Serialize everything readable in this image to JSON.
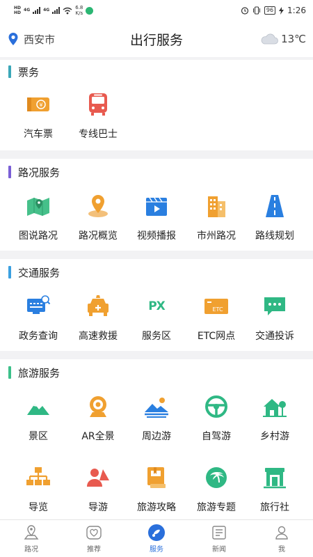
{
  "status_bar": {
    "net_top": "HD",
    "net_bottom": "HD",
    "signal_1": "4G",
    "signal_2": "4G",
    "speed_value": "6.8",
    "speed_unit": "K/s",
    "battery": "96",
    "time": "1:26"
  },
  "header": {
    "location": "西安市",
    "title": "出行服务",
    "temperature": "13℃"
  },
  "sections": [
    {
      "title": "票务",
      "accent": "#3ba7b8",
      "items": [
        {
          "label": "汽车票",
          "icon": "ticket-icon"
        },
        {
          "label": "专线巴士",
          "icon": "bus-icon"
        }
      ]
    },
    {
      "title": "路况服务",
      "accent": "#7a5fd6",
      "items": [
        {
          "label": "图说路况",
          "icon": "map-icon"
        },
        {
          "label": "路况概览",
          "icon": "location-pin-icon"
        },
        {
          "label": "视频播报",
          "icon": "video-icon"
        },
        {
          "label": "市州路况",
          "icon": "city-buildings-icon"
        },
        {
          "label": "路线规划",
          "icon": "highway-icon"
        }
      ]
    },
    {
      "title": "交通服务",
      "accent": "#3ba0e0",
      "items": [
        {
          "label": "政务查询",
          "icon": "government-query-icon"
        },
        {
          "label": "高速救援",
          "icon": "rescue-car-icon"
        },
        {
          "label": "服务区",
          "icon": "service-area-icon",
          "icon_text": "PX"
        },
        {
          "label": "ETC网点",
          "icon": "etc-card-icon",
          "icon_text": "ETC"
        },
        {
          "label": "交通投诉",
          "icon": "complaint-chat-icon"
        }
      ]
    },
    {
      "title": "旅游服务",
      "accent": "#3cc08a",
      "items": [
        {
          "label": "景区",
          "icon": "scenic-mountain-icon"
        },
        {
          "label": "AR全景",
          "icon": "ar-panorama-icon"
        },
        {
          "label": "周边游",
          "icon": "landscape-icon"
        },
        {
          "label": "自驾游",
          "icon": "steering-wheel-icon"
        },
        {
          "label": "乡村游",
          "icon": "village-house-icon"
        },
        {
          "label": "导览",
          "icon": "org-chart-icon"
        },
        {
          "label": "导游",
          "icon": "tour-guide-icon"
        },
        {
          "label": "旅游攻略",
          "icon": "guide-book-icon"
        },
        {
          "label": "旅游专题",
          "icon": "island-icon"
        },
        {
          "label": "旅行社",
          "icon": "travel-agency-icon"
        }
      ]
    }
  ],
  "tabbar": {
    "tabs": [
      {
        "label": "路况",
        "icon": "road-tab-icon"
      },
      {
        "label": "推荐",
        "icon": "heart-tab-icon"
      },
      {
        "label": "服务",
        "icon": "service-tab-icon",
        "active": true
      },
      {
        "label": "新闻",
        "icon": "news-tab-icon"
      },
      {
        "label": "我",
        "icon": "profile-tab-icon"
      }
    ]
  },
  "colors": {
    "blue": "#2a6fdb",
    "orange": "#f0a030",
    "green": "#2fb884",
    "red": "#e85a4f"
  }
}
